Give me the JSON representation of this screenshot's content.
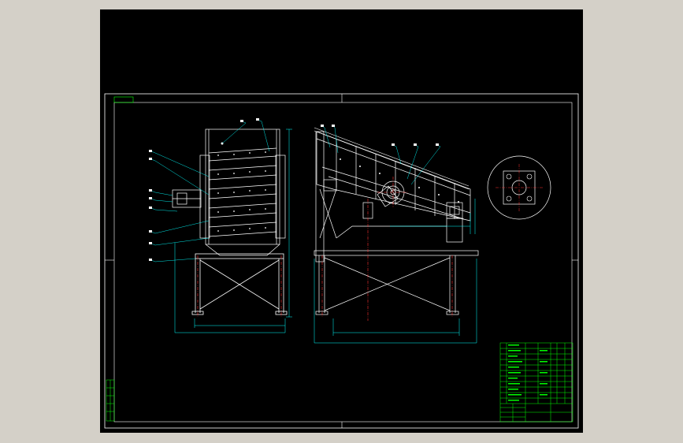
{
  "drawing": {
    "corner_tag": "",
    "detail_label": "",
    "notes_left": [],
    "notes_right": [],
    "title_block_code": "",
    "balloons_left": [],
    "balloons_middle": []
  },
  "colors": {
    "background": "#000000",
    "frame": "#ffffff",
    "machine": "#ffffff",
    "leader": "#00ffff",
    "dimension": "#00ffff",
    "centerline": "#ff0000",
    "title_block": "#00ff00",
    "window": "#d4d0c8"
  }
}
